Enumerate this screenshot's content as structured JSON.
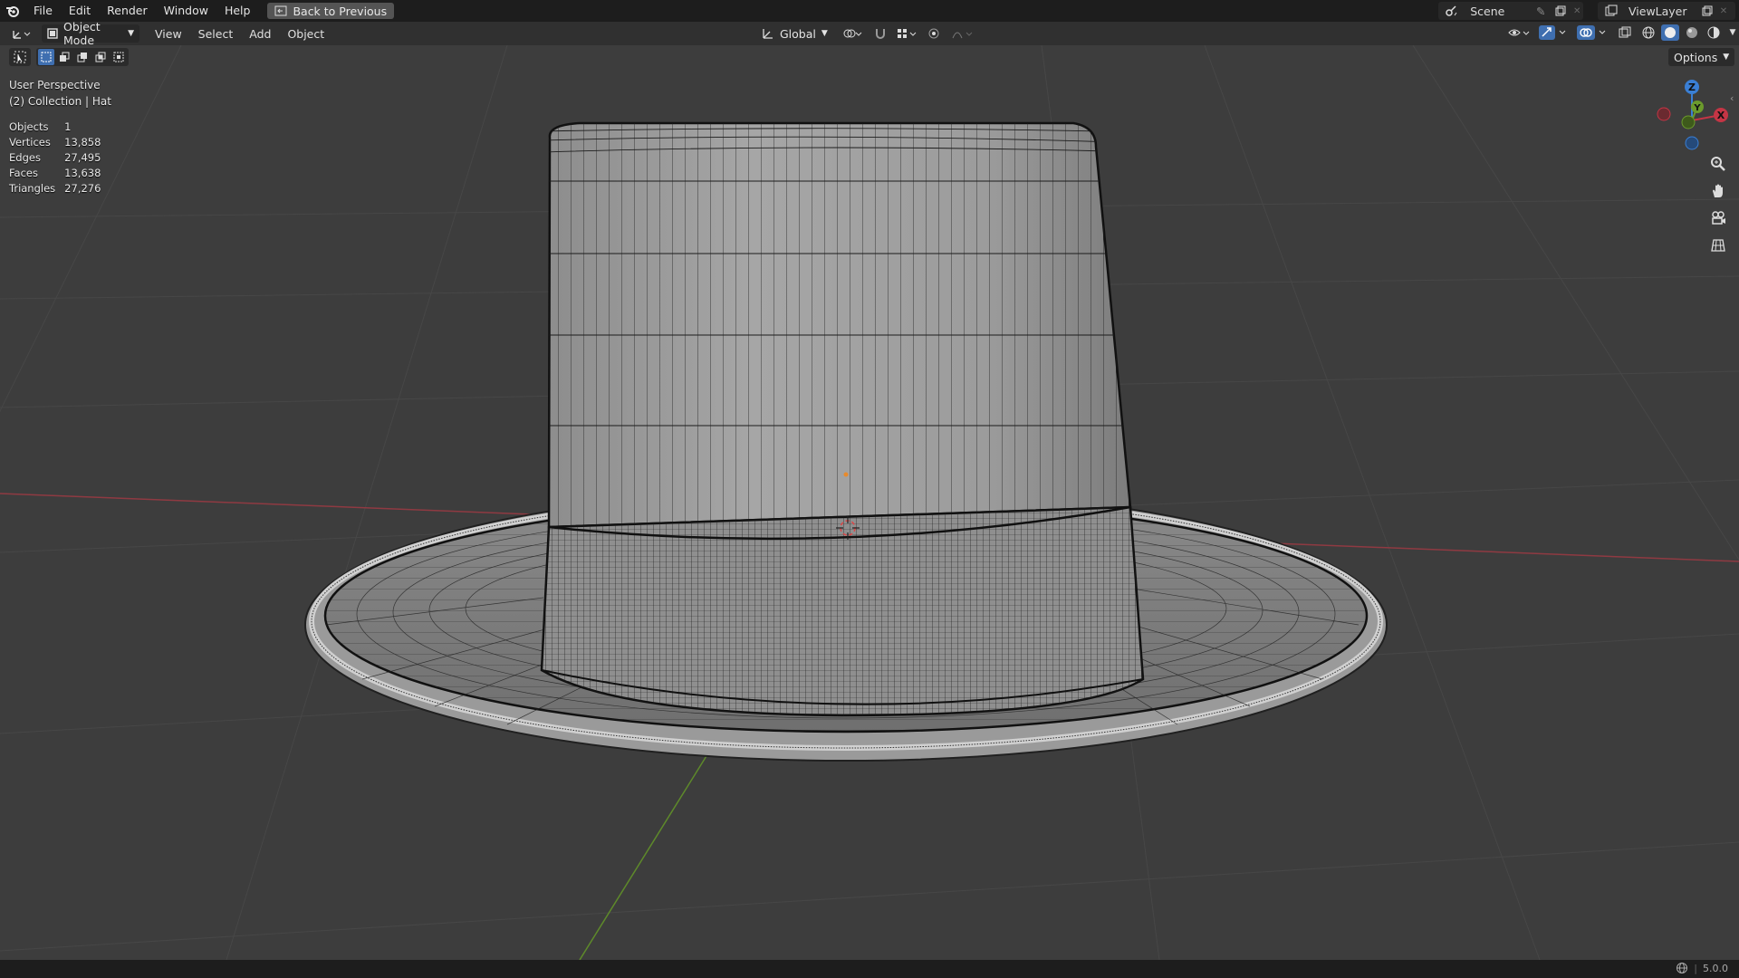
{
  "topbar": {
    "menus": [
      "File",
      "Edit",
      "Render",
      "Window",
      "Help"
    ],
    "back_button": "Back to Previous",
    "scene": "Scene",
    "view_layer": "ViewLayer"
  },
  "header": {
    "mode": "Object Mode",
    "menus": [
      "View",
      "Select",
      "Add",
      "Object"
    ],
    "orientation": "Global",
    "options": "Options"
  },
  "viewport": {
    "view_name": "User Perspective",
    "collection": "(2) Collection | Hat",
    "stats": [
      {
        "label": "Objects",
        "value": "1"
      },
      {
        "label": "Vertices",
        "value": "13,858"
      },
      {
        "label": "Edges",
        "value": "27,495"
      },
      {
        "label": "Faces",
        "value": "13,638"
      },
      {
        "label": "Triangles",
        "value": "27,276"
      }
    ],
    "gizmo_axes": [
      "X",
      "Y",
      "Z"
    ]
  },
  "statusbar": {
    "version": "5.0.0"
  },
  "colors": {
    "background": "#3d3d3d",
    "x_axis": "#c43545",
    "y_axis": "#6b9a2c",
    "z_axis": "#3a7fd5",
    "selection_origin": "#e88a2c"
  }
}
